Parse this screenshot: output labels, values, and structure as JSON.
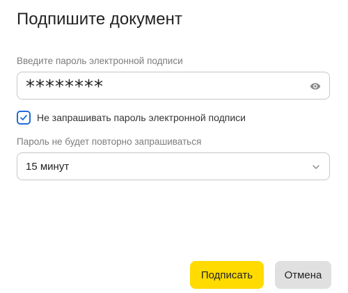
{
  "dialog": {
    "title": "Подпишите документ"
  },
  "password": {
    "label": "Введите пароль электронной подписи",
    "value": "********",
    "visibility_icon": "eye-icon"
  },
  "remember": {
    "checked": true,
    "label": "Не запрашивать пароль электронной подписи",
    "check_icon": "checkmark-icon"
  },
  "period": {
    "label": "Пароль не будет повторно запрашиваться",
    "selected": "15 минут",
    "dropdown_icon": "chevron-down-icon"
  },
  "actions": {
    "sign_label": "Подписать",
    "cancel_label": "Отмена"
  },
  "colors": {
    "primary_button": "#ffdb00",
    "secondary_button": "#e0e0e0",
    "checkbox_accent": "#1f6bd6",
    "input_border": "#c6c6c6",
    "label_text": "#7c7c7c"
  }
}
